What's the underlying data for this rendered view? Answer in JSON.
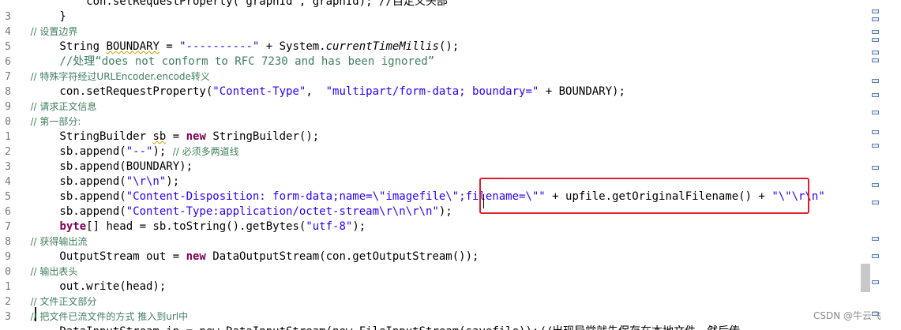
{
  "editor": {
    "line_numbers": [
      "",
      "3",
      "4",
      "5",
      "6",
      "7",
      "8",
      "9",
      "0",
      "1",
      "2",
      "3",
      "4",
      "5",
      "6",
      "7",
      "8",
      "9",
      "0",
      "1",
      "2",
      "3",
      ""
    ],
    "lines": [
      [
        {
          "t": "            con.setRequestProperty(\"graphId\", graphId); //自定义头部",
          "c": ""
        }
      ],
      [
        {
          "t": "        }",
          "c": ""
        }
      ],
      [
        {
          "t": "        // 设置边界",
          "c": "cz"
        }
      ],
      [
        {
          "t": "        String ",
          "c": ""
        },
        {
          "t": "BOUNDARY",
          "c": "sq"
        },
        {
          "t": " = ",
          "c": ""
        },
        {
          "t": "\"----------\"",
          "c": "s"
        },
        {
          "t": " + System.",
          "c": ""
        },
        {
          "t": "currentTimeMillis",
          "c": "i"
        },
        {
          "t": "();",
          "c": ""
        }
      ],
      [
        {
          "t": "        //处理“does not conform to RFC 7230 and has been ignored”",
          "c": "c"
        }
      ],
      [
        {
          "t": "        // 特殊字符经过URLEncoder.encode转义",
          "c": "cz"
        }
      ],
      [
        {
          "t": "        con.setRequestProperty(",
          "c": ""
        },
        {
          "t": "\"Content-Type\"",
          "c": "s"
        },
        {
          "t": ",  ",
          "c": ""
        },
        {
          "t": "\"multipart/form-data; boundary=\"",
          "c": "s"
        },
        {
          "t": " + BOUNDARY);",
          "c": ""
        }
      ],
      [
        {
          "t": "        // 请求正文信息",
          "c": "cz"
        }
      ],
      [
        {
          "t": "        // 第一部分:",
          "c": "cz"
        }
      ],
      [
        {
          "t": "        StringBuilder ",
          "c": ""
        },
        {
          "t": "sb",
          "c": "sq"
        },
        {
          "t": " = ",
          "c": ""
        },
        {
          "t": "new",
          "c": "k"
        },
        {
          "t": " StringBuilder();",
          "c": ""
        }
      ],
      [
        {
          "t": "        sb.append(",
          "c": ""
        },
        {
          "t": "\"--\"",
          "c": "s"
        },
        {
          "t": "); ",
          "c": ""
        },
        {
          "t": "// 必须多两道线",
          "c": "cz"
        }
      ],
      [
        {
          "t": "        sb.append(BOUNDARY);",
          "c": ""
        }
      ],
      [
        {
          "t": "        sb.append(",
          "c": ""
        },
        {
          "t": "\"\\r\\n\"",
          "c": "s"
        },
        {
          "t": ");",
          "c": ""
        }
      ],
      [
        {
          "t": "        sb.append(",
          "c": ""
        },
        {
          "t": "\"Content-Disposition: form-data;name=\\\"imagefile\\\";filename=\\\"\"",
          "c": "s"
        },
        {
          "t": " + upfile.getOriginalFilename() + ",
          "c": ""
        },
        {
          "t": "\"\\\"\\r\\n\"",
          "c": "s"
        }
      ],
      [
        {
          "t": "        sb.append(",
          "c": ""
        },
        {
          "t": "\"Content-Type:application/octet-stream\\r\\n\\r\\n\"",
          "c": "s"
        },
        {
          "t": ");",
          "c": ""
        }
      ],
      [
        {
          "t": "        ",
          "c": ""
        },
        {
          "t": "byte",
          "c": "k"
        },
        {
          "t": "[] head = sb.toString().getBytes(",
          "c": ""
        },
        {
          "t": "\"utf-8\"",
          "c": "s"
        },
        {
          "t": ");",
          "c": ""
        }
      ],
      [
        {
          "t": "        // 获得输出流",
          "c": "cz"
        }
      ],
      [
        {
          "t": "        OutputStream out = ",
          "c": ""
        },
        {
          "t": "new",
          "c": "k"
        },
        {
          "t": " DataOutputStream(con.getOutputStream());",
          "c": ""
        }
      ],
      [
        {
          "t": "        // 输出表头",
          "c": "cz"
        }
      ],
      [
        {
          "t": "        out.write(head);",
          "c": ""
        }
      ],
      [
        {
          "t": "        // 文件正文部分",
          "c": "cz"
        }
      ],
      [
        {
          "t": "        // 把文件已流文件的方式 推入到url中",
          "c": "cz"
        }
      ],
      [
        {
          "t": "        DataInputStream in = new DataInputStream(new FileInputStream(savefile));//出现异常就先保存在本地文件，然后传",
          "c": ""
        }
      ]
    ]
  },
  "watermark": "CSDN @牛云飞"
}
